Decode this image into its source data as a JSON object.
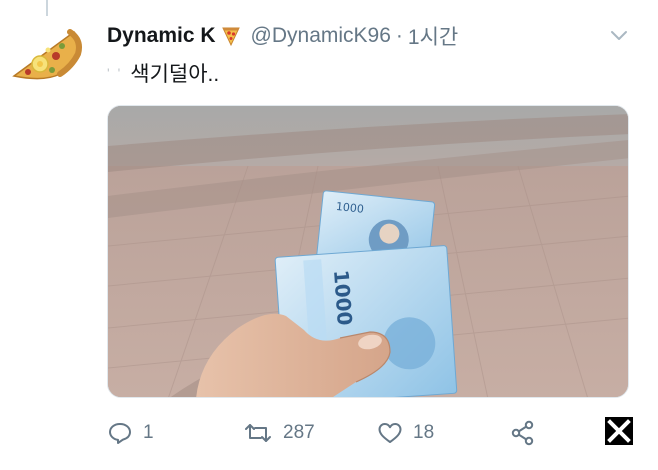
{
  "tweet": {
    "display_name": "Dynamic K",
    "name_emoji": "pizza-emoji",
    "handle": "@DynamicK96",
    "separator": "·",
    "time": "1시간",
    "text_prefix": "' '",
    "text": "색기덜아..",
    "avatar_icon": "pizza-slice-avatar",
    "media_description_icon": "photo"
  },
  "actions": {
    "reply_count": "1",
    "retweet_count": "287",
    "like_count": "18"
  },
  "icons": {
    "reply": "reply-icon",
    "retweet": "retweet-icon",
    "like": "heart-icon",
    "share": "share-icon",
    "more": "chevron-down-icon",
    "close": "close-icon"
  },
  "colors": {
    "text_primary": "#14171a",
    "text_secondary": "#657786",
    "border": "#e1e8ed"
  }
}
